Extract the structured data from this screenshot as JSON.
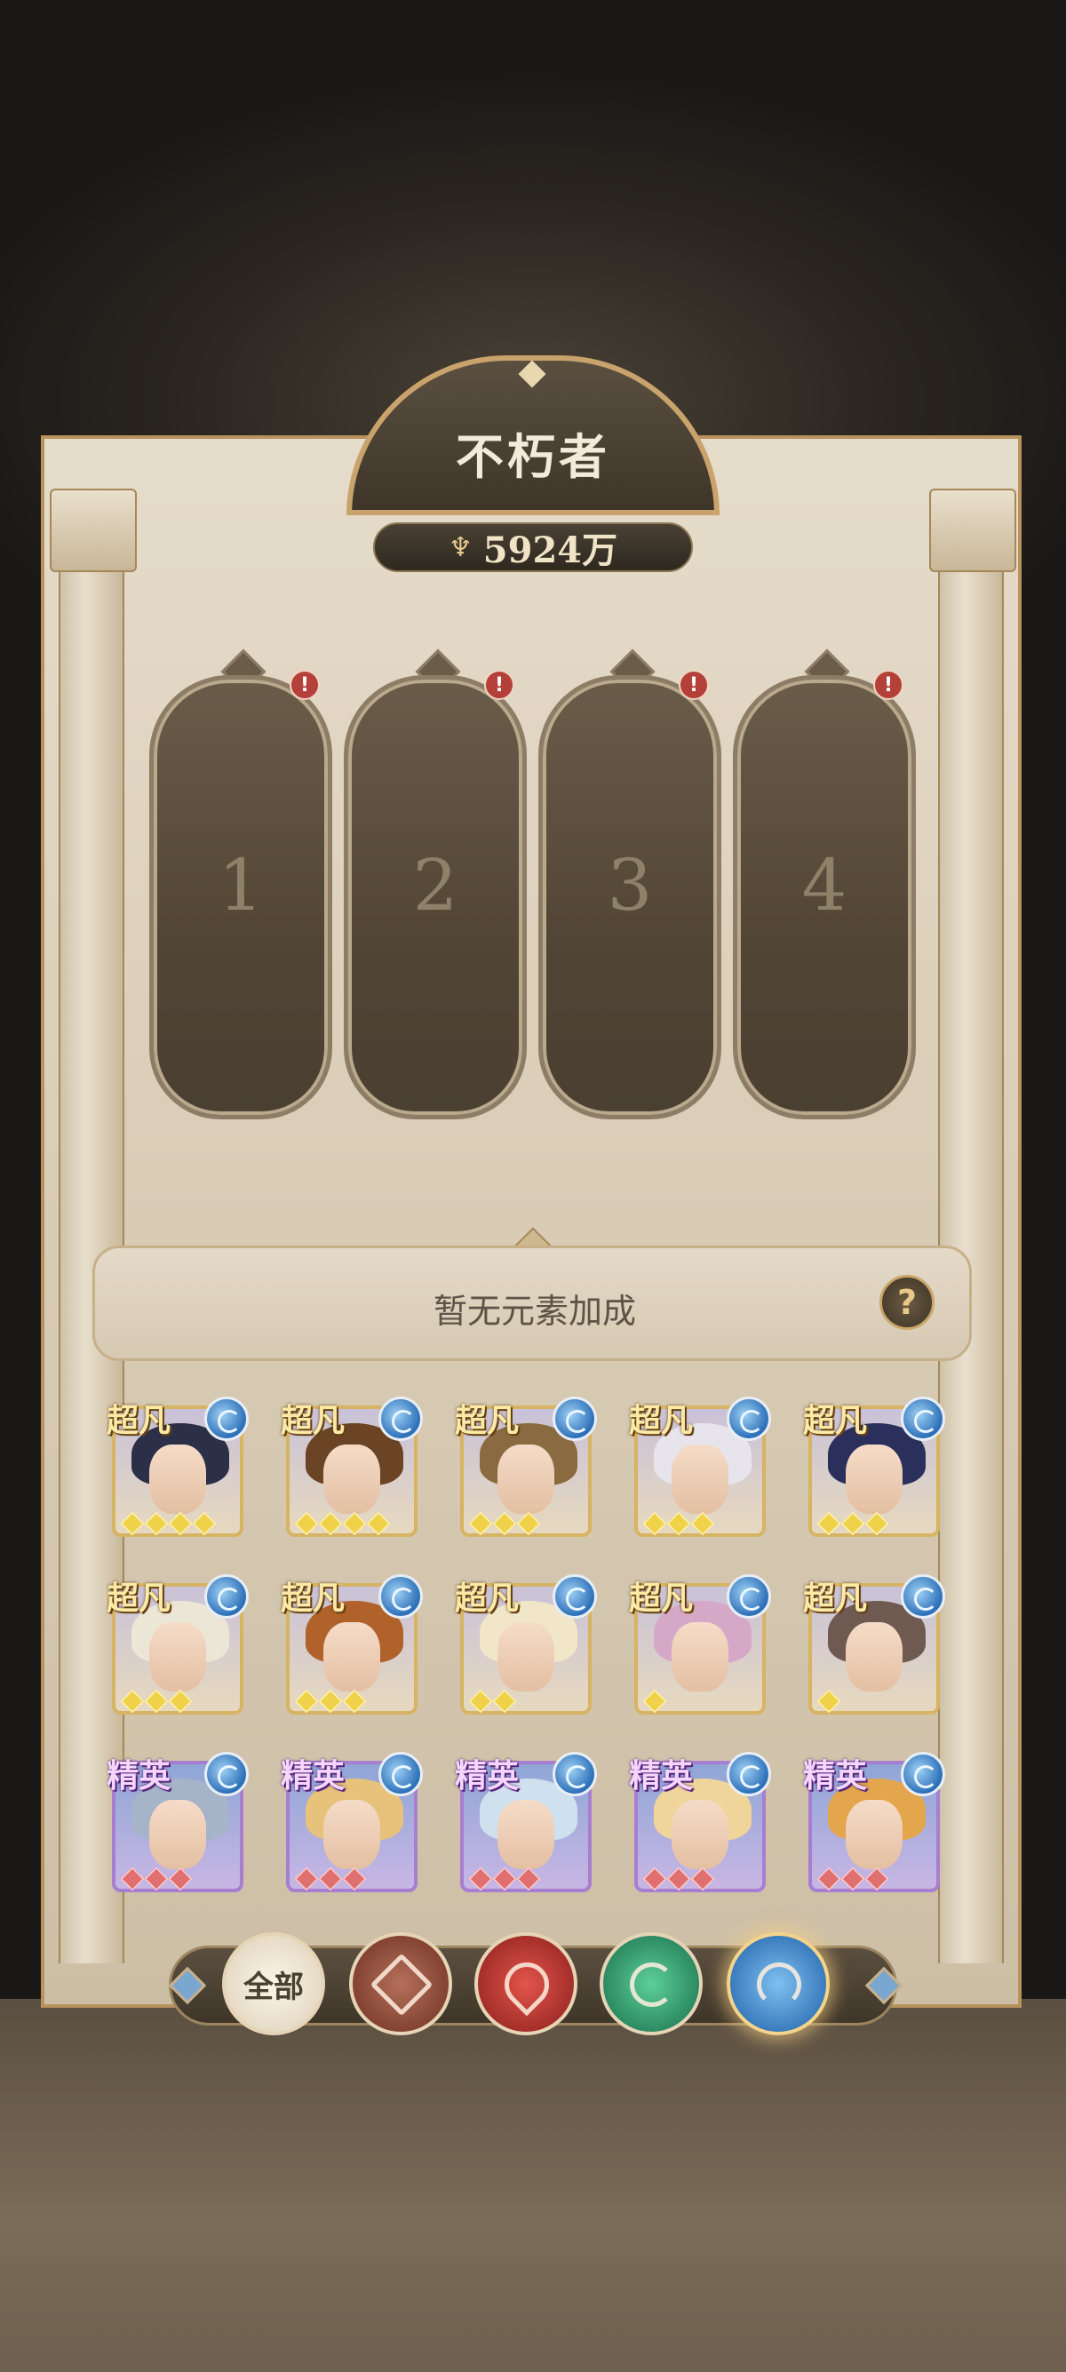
{
  "header": {
    "title": "不朽者",
    "power_value": "5924万",
    "power_icon": "trident-icon"
  },
  "slots": [
    {
      "label": "1",
      "alert": "!"
    },
    {
      "label": "2",
      "alert": "!"
    },
    {
      "label": "3",
      "alert": "!"
    },
    {
      "label": "4",
      "alert": "!"
    }
  ],
  "bonus": {
    "text": "暂无元素加成",
    "help_label": "?"
  },
  "heroes": [
    {
      "rarity": "超凡",
      "element": "water",
      "stars": 4,
      "hair": "#2c2f48"
    },
    {
      "rarity": "超凡",
      "element": "water",
      "stars": 4,
      "hair": "#6a4424"
    },
    {
      "rarity": "超凡",
      "element": "water",
      "stars": 3,
      "hair": "#8a6a40"
    },
    {
      "rarity": "超凡",
      "element": "water",
      "stars": 3,
      "hair": "#e8e4ec"
    },
    {
      "rarity": "超凡",
      "element": "water",
      "stars": 3,
      "hair": "#2a2f5c"
    },
    {
      "rarity": "超凡",
      "element": "water",
      "stars": 3,
      "hair": "#ece6d6"
    },
    {
      "rarity": "超凡",
      "element": "water",
      "stars": 3,
      "hair": "#b0622a"
    },
    {
      "rarity": "超凡",
      "element": "water",
      "stars": 2,
      "hair": "#f1e7c8"
    },
    {
      "rarity": "超凡",
      "element": "water",
      "stars": 1,
      "hair": "#d6a8c8"
    },
    {
      "rarity": "超凡",
      "element": "water",
      "stars": 1,
      "hair": "#6f5a52"
    },
    {
      "rarity": "精英",
      "element": "water",
      "stars": 3,
      "hair": "#a5b4c8"
    },
    {
      "rarity": "精英",
      "element": "water",
      "stars": 3,
      "hair": "#e6c27a"
    },
    {
      "rarity": "精英",
      "element": "water",
      "stars": 3,
      "hair": "#cfe0ee"
    },
    {
      "rarity": "精英",
      "element": "water",
      "stars": 3,
      "hair": "#f0d59a"
    },
    {
      "rarity": "精英",
      "element": "water",
      "stars": 3,
      "hair": "#e3a64c"
    }
  ],
  "filter": {
    "all_label": "全部",
    "elements": [
      "earth",
      "fire",
      "wind",
      "water"
    ],
    "selected": "water"
  },
  "colors": {
    "accent_gold": "#c9a36b",
    "water": "#2c6fb8",
    "fire": "#8a1e1c",
    "wind": "#186e4a",
    "earth": "#6e2f22"
  }
}
